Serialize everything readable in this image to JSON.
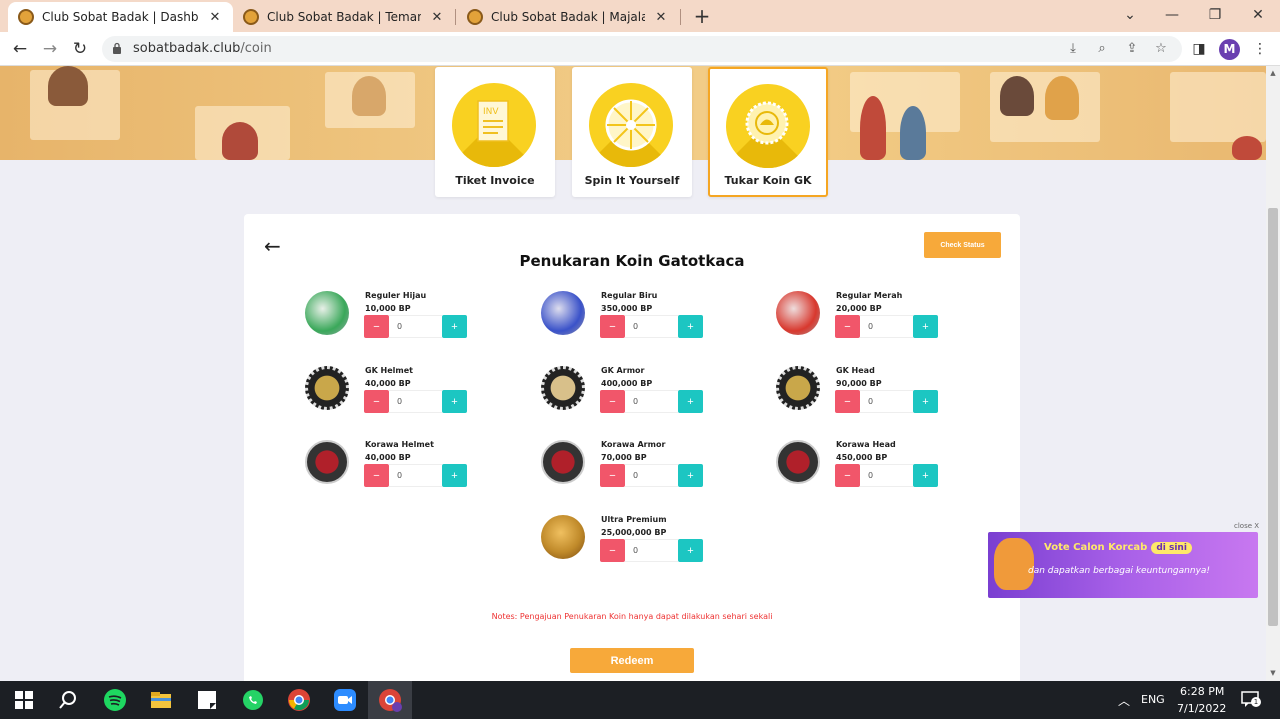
{
  "browser": {
    "tabs": [
      {
        "title": "Club Sobat Badak | Dashboard"
      },
      {
        "title": "Club Sobat Badak | Teman Sobat"
      },
      {
        "title": "Club Sobat Badak | Majalah Dinding"
      }
    ],
    "url_host": "sobatbadak.club",
    "url_path": "/coin",
    "profile_initial": "M"
  },
  "menu": [
    {
      "label": "Tiket Invoice",
      "icon": "invoice-icon",
      "glyph": "INV"
    },
    {
      "label": "Spin It Yourself",
      "icon": "wheel-icon",
      "glyph": ""
    },
    {
      "label": "Tukar Koin GK",
      "icon": "coin-emblem-icon",
      "glyph": ""
    }
  ],
  "page": {
    "title": "Penukaran Koin Gatotkaca",
    "check_status_label": "Check Status",
    "notes": "Notes: Pengajuan Penukaran Koin hanya dapat dilakukan sehari sekali",
    "redeem_label": "Redeem",
    "minus_label": "−",
    "plus_label": "+"
  },
  "coins": [
    {
      "name": "Reguler Hijau",
      "price": "10,000 BP",
      "qty": "0",
      "color": "#3aa85a"
    },
    {
      "name": "Regular Biru",
      "price": "350,000 BP",
      "qty": "0",
      "color": "#3a52c9"
    },
    {
      "name": "Regular Merah",
      "price": "20,000 BP",
      "qty": "0",
      "color": "#d8382e"
    },
    {
      "name": "GK Helmet",
      "price": "40,000 BP",
      "qty": "0",
      "color": "#c9a74a"
    },
    {
      "name": "GK Armor",
      "price": "400,000 BP",
      "qty": "0",
      "color": "#c9a74a"
    },
    {
      "name": "GK Head",
      "price": "90,000 BP",
      "qty": "0",
      "color": "#c9a74a"
    },
    {
      "name": "Korawa Helmet",
      "price": "40,000 BP",
      "qty": "0",
      "color": "#b0202a"
    },
    {
      "name": "Korawa Armor",
      "price": "70,000 BP",
      "qty": "0",
      "color": "#b0202a"
    },
    {
      "name": "Korawa Head",
      "price": "450,000 BP",
      "qty": "0",
      "color": "#b0202a"
    },
    {
      "name": "Ultra Premium",
      "price": "25,000,000 BP",
      "qty": "0",
      "color": "#c08a2a"
    }
  ],
  "promo": {
    "line1": "Vote Calon Korcab",
    "line1_badge": "di sini",
    "line2": "dan dapatkan berbagai keuntungannya!",
    "close": "close X"
  },
  "taskbar": {
    "lang": "ENG",
    "time": "6:28 PM",
    "date": "7/1/2022",
    "notif_count": "1"
  }
}
